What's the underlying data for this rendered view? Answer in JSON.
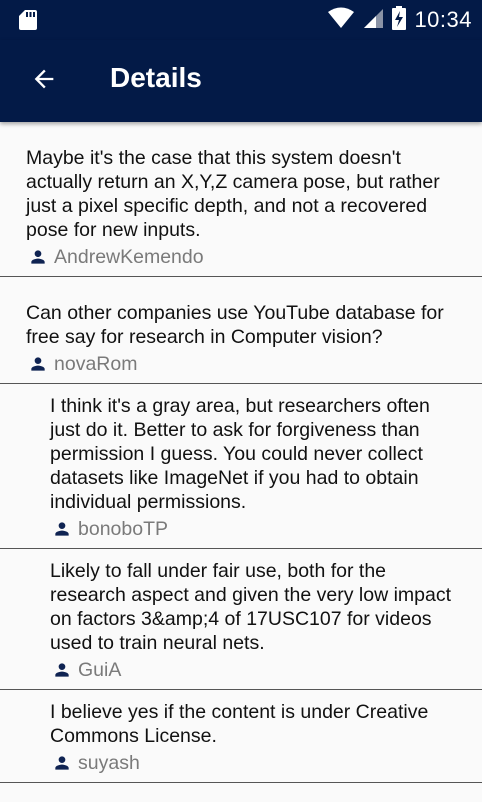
{
  "status_bar": {
    "time": "10:34",
    "icons": [
      "sd-card-icon",
      "wifi-icon",
      "cell-signal-icon",
      "battery-charging-icon"
    ]
  },
  "app_bar": {
    "title": "Details",
    "back_icon": "arrow-left-icon"
  },
  "comments": [
    {
      "text": "Maybe it's the case that this system doesn't actually return an X,Y,Z camera pose, but rather just a pixel specific depth, and not a recovered pose for new inputs.",
      "author": "AndrewKemendo",
      "reply": false
    },
    {
      "text": "Can other companies use YouTube database for free say for research in Computer vision?",
      "author": "novaRom",
      "reply": false
    },
    {
      "text": "I think it's a gray area, but researchers often just do it. Better to ask for forgiveness than permission I guess. You could never collect datasets like ImageNet if you had to obtain individual permissions.",
      "author": "bonoboTP",
      "reply": true
    },
    {
      "text": "Likely to fall under fair use, both for the research aspect and given the very low impact on factors 3&amp;4 of 17USC107 for videos used to train neural nets.",
      "author": "GuiA",
      "reply": true
    },
    {
      "text": "I believe yes if the content is under Creative Commons License.",
      "author": "suyash",
      "reply": true
    }
  ],
  "colors": {
    "primary": "#031a47",
    "author_icon": "#0f2352",
    "author_text": "#7a7a7a",
    "background": "#fafafa"
  }
}
